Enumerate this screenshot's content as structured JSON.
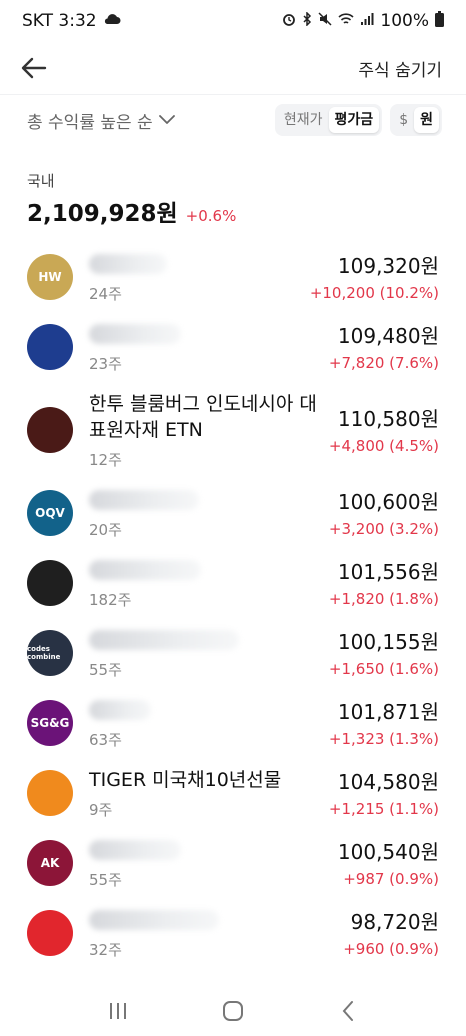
{
  "status_bar": {
    "carrier_time": "SKT 3:32",
    "battery": "100%",
    "icons": [
      "cloud-icon",
      "alarm-icon",
      "bluetooth-icon",
      "mute-icon",
      "wifi-icon",
      "signal-icon",
      "battery-icon"
    ]
  },
  "header": {
    "back_icon": "arrow-left-icon",
    "hide_stocks_label": "주식 숨기기"
  },
  "filters": {
    "sort_label": "총 수익률 높은 순",
    "price_toggle": {
      "options": [
        "현재가",
        "평가금"
      ],
      "selected": "평가금"
    },
    "currency_toggle": {
      "options": [
        "$",
        "원"
      ],
      "selected": "원"
    }
  },
  "summary": {
    "section": "국내",
    "total_value": "2,109,928원",
    "total_change": "+0.6%"
  },
  "holdings": [
    {
      "name": "",
      "blurred": true,
      "shares": "24주",
      "value": "109,320원",
      "change": "+10,200 (10.2%)",
      "logo_color": "#c9a855",
      "logo_text": "HW"
    },
    {
      "name": "",
      "blurred": true,
      "shares": "23주",
      "value": "109,480원",
      "change": "+7,820 (7.6%)",
      "logo_color": "#1e3d8f",
      "logo_text": ""
    },
    {
      "name": "한투 블룸버그 인도네시아 대표원자재 ETN",
      "blurred": false,
      "shares": "12주",
      "value": "110,580원",
      "change": "+4,800 (4.5%)",
      "logo_color": "#4a1a17",
      "logo_text": ""
    },
    {
      "name": "",
      "blurred": true,
      "shares": "20주",
      "value": "100,600원",
      "change": "+3,200 (3.2%)",
      "logo_color": "#12628a",
      "logo_text": "OQV"
    },
    {
      "name": "",
      "blurred": true,
      "shares": "182주",
      "value": "101,556원",
      "change": "+1,820 (1.8%)",
      "logo_color": "#1f1f1f",
      "logo_text": ""
    },
    {
      "name": "",
      "blurred": true,
      "shares": "55주",
      "value": "100,155원",
      "change": "+1,650 (1.6%)",
      "logo_color": "#283244",
      "logo_text": "codes combine"
    },
    {
      "name": "",
      "blurred": true,
      "shares": "63주",
      "value": "101,871원",
      "change": "+1,323 (1.3%)",
      "logo_color": "#6b1378",
      "logo_text": "SG&G"
    },
    {
      "name": "TIGER 미국채10년선물",
      "blurred": false,
      "shares": "9주",
      "value": "104,580원",
      "change": "+1,215 (1.1%)",
      "logo_color": "#f08a1d",
      "logo_text": ""
    },
    {
      "name": "",
      "blurred": true,
      "shares": "55주",
      "value": "100,540원",
      "change": "+987 (0.9%)",
      "logo_color": "#8c1538",
      "logo_text": "AK"
    },
    {
      "name": "",
      "blurred": true,
      "shares": "32주",
      "value": "98,720원",
      "change": "+960 (0.9%)",
      "logo_color": "#e1262d",
      "logo_text": ""
    }
  ],
  "nav": [
    "recents-icon",
    "home-icon",
    "back-icon"
  ]
}
